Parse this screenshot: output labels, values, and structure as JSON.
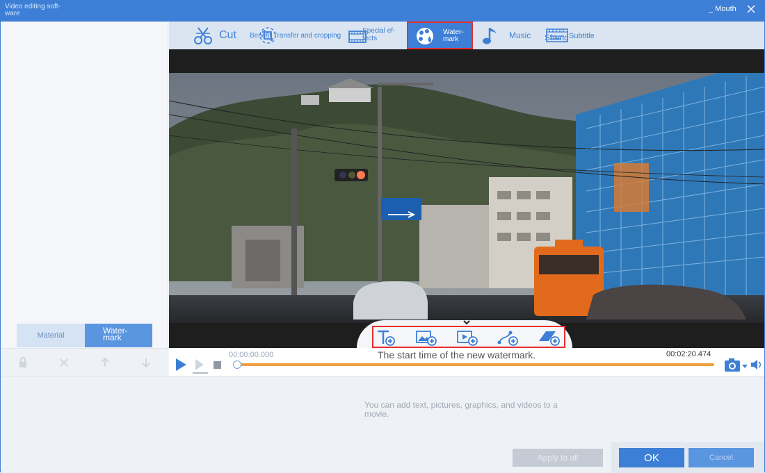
{
  "window": {
    "title": "Video editing soft-ware",
    "minimize_label": "_ Mouth",
    "close_icon": "close-icon"
  },
  "toolbar": {
    "items": [
      {
        "label": "Cut",
        "icon": "cut-icon"
      },
      {
        "label": "Benefit Transfer and cropping",
        "icon": "crop-icon"
      },
      {
        "label": "Special ef-fects",
        "icon": "film-effects-icon"
      },
      {
        "label": "Water-mark",
        "icon": "watermark-icon"
      },
      {
        "label": "Music",
        "icon": "music-note-icon"
      },
      {
        "label": "Sheng",
        "icon": "subtitle-icon"
      },
      {
        "label": "Subtitle",
        "icon": "subtitle-icon"
      }
    ],
    "selected": "Water-mark"
  },
  "left_panel": {
    "tabs": [
      {
        "label": "Material"
      },
      {
        "label": "Water-mark"
      }
    ],
    "tools": [
      "lock-icon",
      "delete-icon",
      "move-up-icon",
      "move-down-icon"
    ]
  },
  "watermark_tools": [
    "add-text-watermark-icon",
    "add-image-watermark-icon",
    "add-video-watermark-icon",
    "add-graphic-watermark-icon",
    "add-mosaic-watermark-icon"
  ],
  "timeline": {
    "start_time": "00:00:00.000",
    "end_time": "00:02:20.474",
    "tooltip": "The start time of the new watermark.",
    "progress": 0
  },
  "bottom": {
    "hint": "You can add text, pictures, graphics, and videos to a movie.",
    "apply_all_label": "Apply to all",
    "ok_label": "OK",
    "cancel_label": "Cancel"
  },
  "colors": {
    "accent": "#3d7fd6",
    "highlight_border": "#e53030",
    "timeline_track": "#f0a040"
  }
}
